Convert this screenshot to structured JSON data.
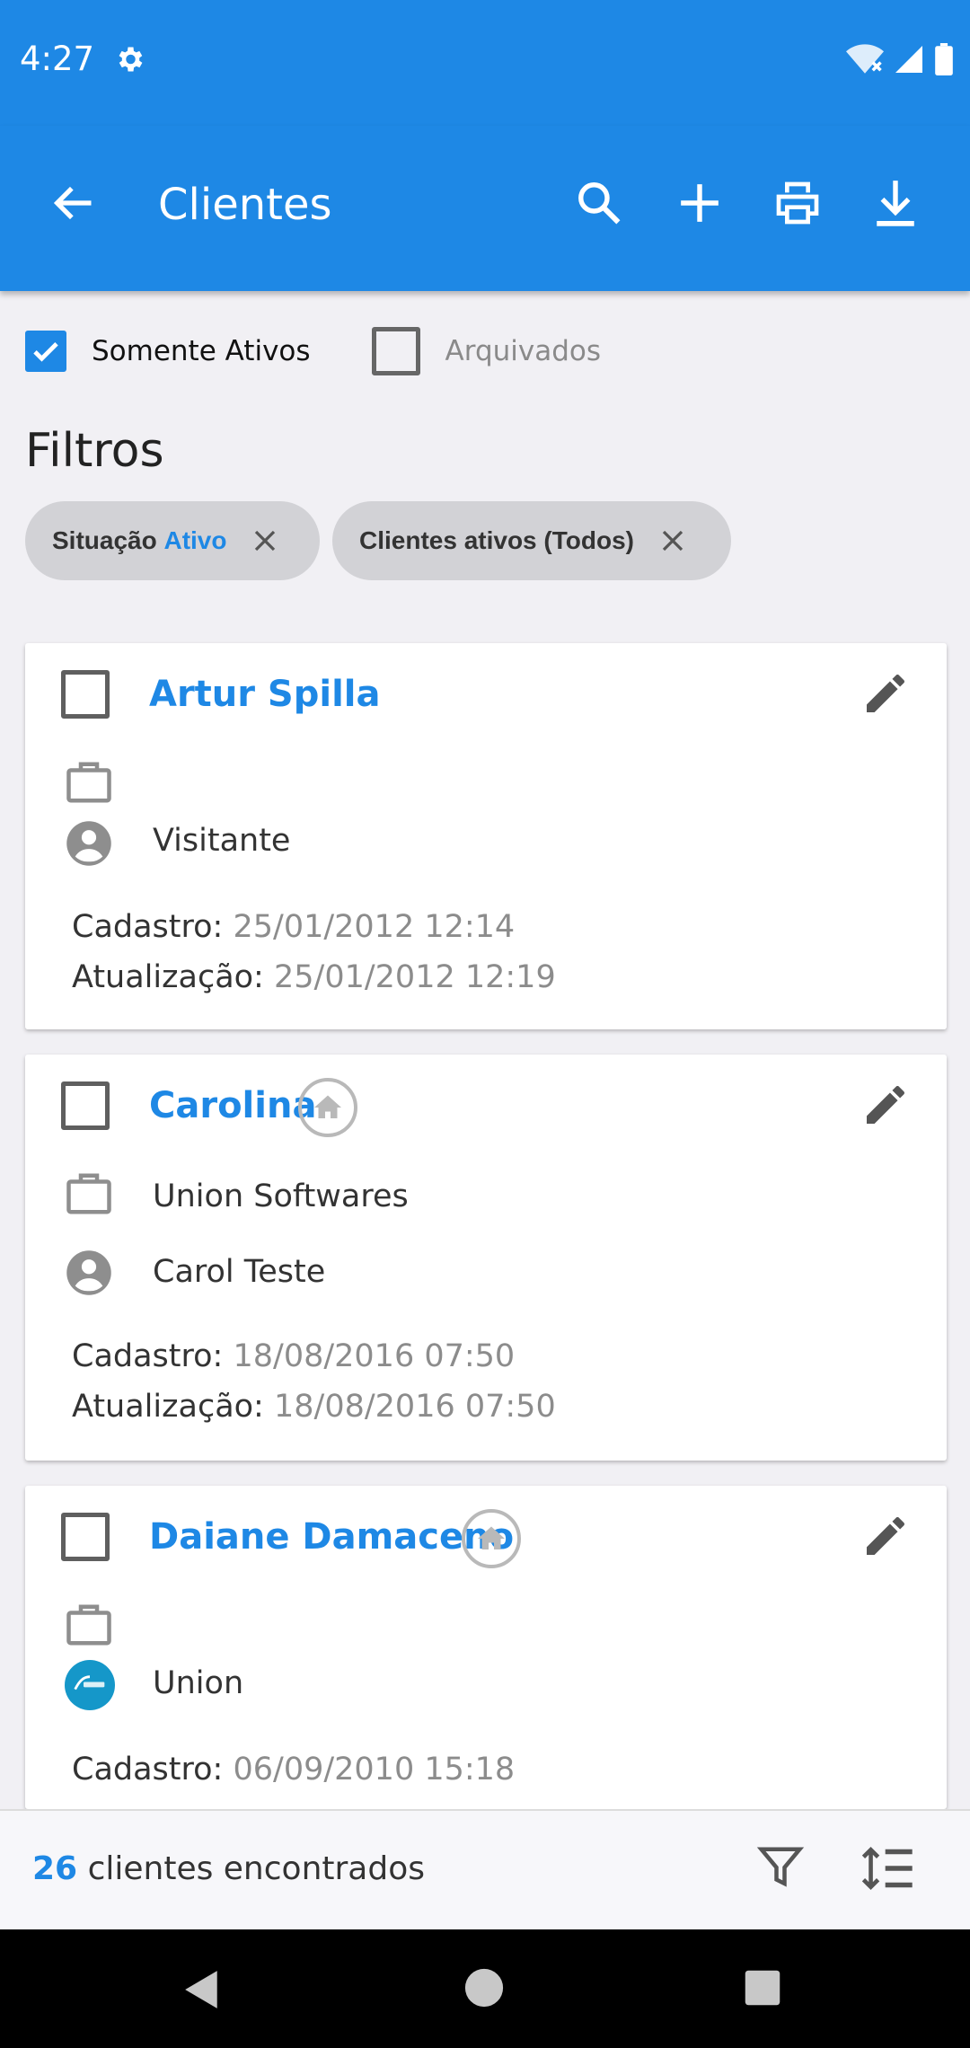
{
  "status_bar": {
    "time": "4:27",
    "icons": [
      "gear-icon",
      "wifi-icon",
      "signal-icon",
      "battery-icon"
    ]
  },
  "app_bar": {
    "title": "Clientes",
    "actions": [
      "search-icon",
      "add-icon",
      "print-icon",
      "download-icon"
    ]
  },
  "toggles": {
    "only_active": {
      "label": "Somente Ativos",
      "checked": true
    },
    "archived": {
      "label": "Arquivados",
      "checked": false
    }
  },
  "filters": {
    "title": "Filtros",
    "chips": [
      {
        "key": "Situação",
        "value": "Ativo"
      },
      {
        "label": "Clientes ativos (Todos)"
      }
    ]
  },
  "clients": [
    {
      "name": "Artur Spilla",
      "has_home_badge": false,
      "company": "",
      "contact": "Visitante",
      "contact_icon": "person-icon",
      "cadastro_label": "Cadastro:",
      "cadastro": "25/01/2012 12:14",
      "atualizacao_label": "Atualização:",
      "atualizacao": "25/01/2012 12:19"
    },
    {
      "name": "Carolina",
      "has_home_badge": true,
      "company": "Union Softwares",
      "contact": "Carol Teste",
      "contact_icon": "person-icon",
      "cadastro_label": "Cadastro:",
      "cadastro": "18/08/2016 07:50",
      "atualizacao_label": "Atualização:",
      "atualizacao": "18/08/2016 07:50"
    },
    {
      "name": "Daiane Damaceno",
      "has_home_badge": true,
      "company": "",
      "contact": "Union",
      "contact_icon": "union-logo-avatar",
      "cadastro_label": "Cadastro:",
      "cadastro": "06/09/2010 15:18"
    }
  ],
  "footer": {
    "count": "26",
    "count_label": "clientes encontrados",
    "actions": [
      "filter-icon",
      "sort-icon"
    ]
  },
  "colors": {
    "primary": "#1e88e5",
    "chip_bg": "#d2d2d6",
    "muted_text": "#8c8c8c"
  }
}
